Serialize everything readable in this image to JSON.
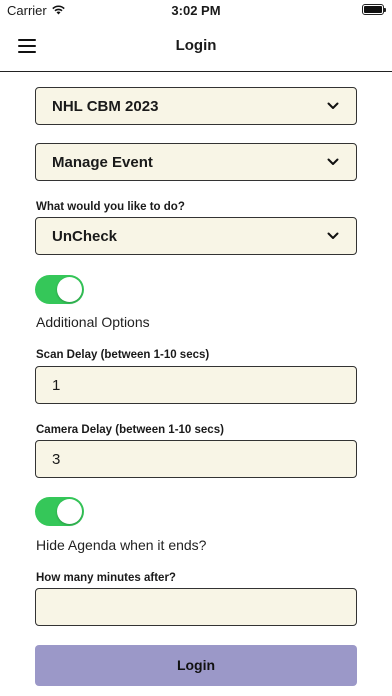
{
  "status": {
    "carrier": "Carrier",
    "time": "3:02 PM"
  },
  "nav": {
    "title": "Login"
  },
  "selects": {
    "event": "NHL CBM 2023",
    "mode": "Manage Event",
    "action_label": "What would you like to do?",
    "action": "UnCheck"
  },
  "options": {
    "additional_options_label": "Additional Options",
    "additional_options_on": true,
    "scan_delay_label": "Scan Delay (between 1-10 secs)",
    "scan_delay_value": "1",
    "camera_delay_label": "Camera Delay (between 1-10 secs)",
    "camera_delay_value": "3",
    "hide_agenda_label": "Hide Agenda when it ends?",
    "hide_agenda_on": true,
    "minutes_after_label": "How many minutes after?",
    "minutes_after_value": ""
  },
  "buttons": {
    "login": "Login"
  },
  "colors": {
    "toggle_on": "#35c759",
    "field_bg": "#f8f5e6",
    "login_button": "#9b98c8"
  }
}
